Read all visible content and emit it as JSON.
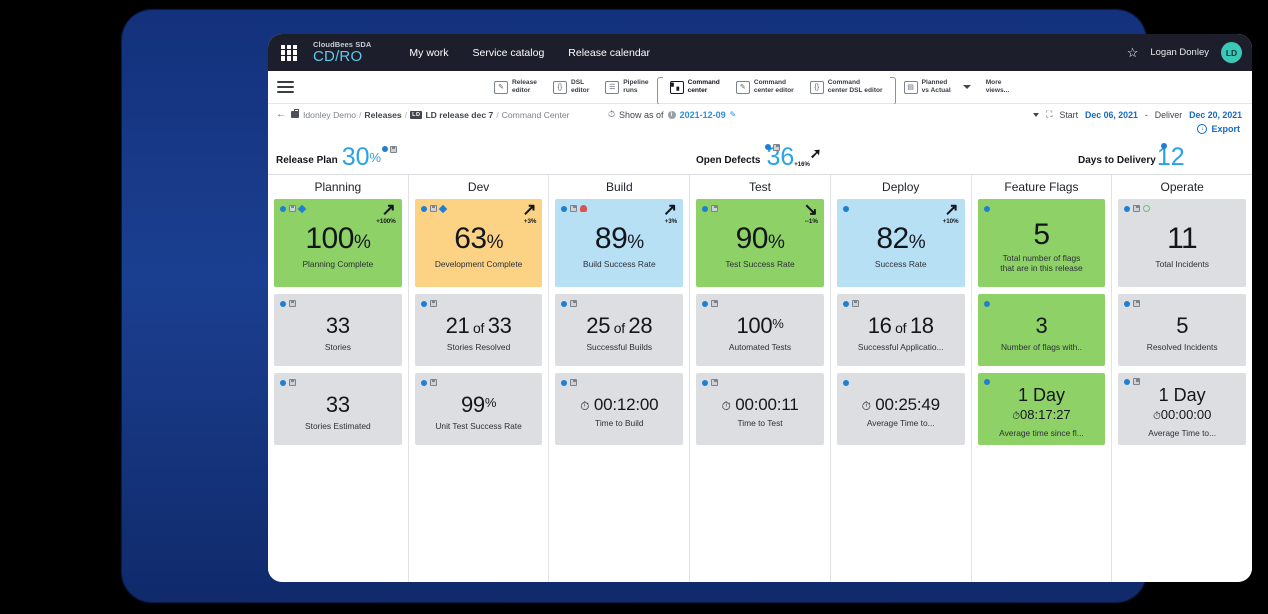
{
  "topnav": {
    "brand_small": "CloudBees SDA",
    "brand_main": "CD/RO",
    "menu": [
      "My work",
      "Service catalog",
      "Release calendar"
    ],
    "star_icon": "star-icon",
    "user_name": "Logan Donley",
    "avatar_initials": "LD",
    "avatar_color": "#3bc8b6"
  },
  "toolbar": {
    "views": [
      {
        "label": "Release\neditor",
        "icon": "pencil-icon",
        "active": false
      },
      {
        "label": "DSL\neditor",
        "icon": "braces-icon",
        "active": false
      },
      {
        "label": "Pipeline\nruns",
        "icon": "list-icon",
        "active": false
      },
      {
        "label": "Command\ncenter",
        "icon": "bar-chart-icon",
        "active": true
      },
      {
        "label": "Command\ncenter editor",
        "icon": "pencil-icon",
        "active": false
      },
      {
        "label": "Command\ncenter DSL editor",
        "icon": "braces-icon",
        "active": false
      },
      {
        "label": "Planned\nvs Actual",
        "icon": "calendar-icon",
        "active": false
      }
    ],
    "more_label": "More\nviews..."
  },
  "breadcrumb": {
    "back_icon": "back-arrow-icon",
    "project": "Idonley Demo",
    "section": "Releases",
    "release_tag": "LD",
    "release": "LD release dec 7",
    "current": "Command Center",
    "show_as_of_label": "Show as of",
    "show_as_of_date": "2021-12-09",
    "edit_icon": "pencil-icon",
    "start_label": "Start",
    "start_date": "Dec 06, 2021",
    "deliver_label": "Deliver",
    "deliver_date": "Dec 20, 2021",
    "export_label": "Export"
  },
  "kpis": [
    {
      "label": "Release Plan",
      "value": "30",
      "suffix": "%",
      "icons": [
        "info-dot",
        "save-icon"
      ],
      "delta": "",
      "trend": ""
    },
    {
      "label": "Open Defects",
      "value": "36",
      "suffix": "",
      "icons": [
        "info-dot",
        "save-icon"
      ],
      "delta": "+16%",
      "trend": "up"
    },
    {
      "label": "Days to Delivery",
      "value": "12",
      "suffix": "",
      "icons": [
        "info-dot"
      ],
      "delta": "",
      "trend": ""
    }
  ],
  "columns": [
    {
      "name": "Planning",
      "cards": [
        {
          "size": "big",
          "bg": "#8ed167",
          "icons": [
            "info-dot",
            "save-icon",
            "diamond-icon"
          ],
          "value": "100",
          "pct": "%",
          "caption": "Planning Complete",
          "trend": "up",
          "delta": "+100%"
        },
        {
          "size": "mid",
          "bg": "#dcdee1",
          "icons": [
            "info-dot",
            "save-icon"
          ],
          "value": "33",
          "caption": "Stories"
        },
        {
          "size": "mid",
          "bg": "#dcdee1",
          "icons": [
            "info-dot",
            "save-icon"
          ],
          "value": "33",
          "caption": "Stories Estimated"
        }
      ]
    },
    {
      "name": "Dev",
      "cards": [
        {
          "size": "big",
          "bg": "#fcd385",
          "icons": [
            "info-dot",
            "save-icon",
            "diamond-icon"
          ],
          "value": "63",
          "pct": "%",
          "caption": "Development Complete",
          "trend": "up",
          "delta": "+3%"
        },
        {
          "size": "mid",
          "bg": "#dcdee1",
          "icons": [
            "info-dot",
            "save-icon"
          ],
          "value": "21",
          "of": "of",
          "value2": "33",
          "caption": "Stories Resolved"
        },
        {
          "size": "mid",
          "bg": "#dcdee1",
          "icons": [
            "info-dot",
            "save-icon"
          ],
          "value": "99",
          "pct": "%",
          "caption": "Unit Test Success Rate"
        }
      ]
    },
    {
      "name": "Build",
      "cards": [
        {
          "size": "big",
          "bg": "#b8e0f5",
          "icons": [
            "info-dot",
            "save-icon",
            "plug-icon"
          ],
          "value": "89",
          "pct": "%",
          "caption": "Build Success Rate",
          "trend": "up",
          "delta": "+3%"
        },
        {
          "size": "mid",
          "bg": "#dcdee1",
          "icons": [
            "info-dot",
            "save-icon"
          ],
          "value": "25",
          "of": "of",
          "value2": "28",
          "caption": "Successful Builds"
        },
        {
          "size": "mid",
          "bg": "#dcdee1",
          "icons": [
            "info-dot",
            "save-icon"
          ],
          "clock": true,
          "value": "00:12:00",
          "caption": "Time to Build"
        }
      ]
    },
    {
      "name": "Test",
      "cards": [
        {
          "size": "big",
          "bg": "#8ed167",
          "icons": [
            "info-dot",
            "save-icon"
          ],
          "value": "90",
          "pct": "%",
          "caption": "Test Success Rate",
          "trend": "down",
          "delta": "--1%"
        },
        {
          "size": "mid",
          "bg": "#dcdee1",
          "icons": [
            "info-dot",
            "save-icon"
          ],
          "value": "100",
          "pct": "%",
          "caption": "Automated Tests"
        },
        {
          "size": "mid",
          "bg": "#dcdee1",
          "icons": [
            "info-dot",
            "save-icon"
          ],
          "clock": true,
          "value": "00:00:11",
          "caption": "Time to Test"
        }
      ]
    },
    {
      "name": "Deploy",
      "cards": [
        {
          "size": "big",
          "bg": "#b8e0f5",
          "icons": [
            "info-dot"
          ],
          "value": "82",
          "pct": "%",
          "caption": "Success Rate",
          "trend": "up",
          "delta": "+10%"
        },
        {
          "size": "mid",
          "bg": "#dcdee1",
          "icons": [
            "info-dot",
            "save-icon"
          ],
          "value": "16",
          "of": "of",
          "value2": "18",
          "caption": "Successful Applicatio..."
        },
        {
          "size": "mid",
          "bg": "#dcdee1",
          "icons": [
            "info-dot"
          ],
          "clock": true,
          "value": "00:25:49",
          "caption": "Average Time to..."
        }
      ]
    },
    {
      "name": "Feature Flags",
      "cards": [
        {
          "size": "big",
          "bg": "#8ed167",
          "icons": [
            "info-dot"
          ],
          "value": "5",
          "caption": "Total number of flags\nthat are in this release"
        },
        {
          "size": "mid",
          "bg": "#8ed167",
          "icons": [
            "info-dot"
          ],
          "value": "3",
          "caption": "Number of flags with.."
        },
        {
          "size": "mid",
          "bg": "#8ed167",
          "icons": [
            "info-dot"
          ],
          "value": "1 Day",
          "subtime": "08:17:27",
          "caption": "Average time since fl..."
        }
      ]
    },
    {
      "name": "Operate",
      "cards": [
        {
          "size": "big",
          "bg": "#dcdee1",
          "icons": [
            "info-dot",
            "save-icon",
            "ring-icon"
          ],
          "value": "11",
          "caption": "Total Incidents"
        },
        {
          "size": "mid",
          "bg": "#dcdee1",
          "icons": [
            "info-dot",
            "save-icon"
          ],
          "value": "5",
          "caption": "Resolved Incidents"
        },
        {
          "size": "mid",
          "bg": "#dcdee1",
          "icons": [
            "info-dot",
            "save-icon"
          ],
          "value": "1 Day",
          "subtime": "00:00:00",
          "caption": "Average Time to..."
        }
      ]
    }
  ]
}
